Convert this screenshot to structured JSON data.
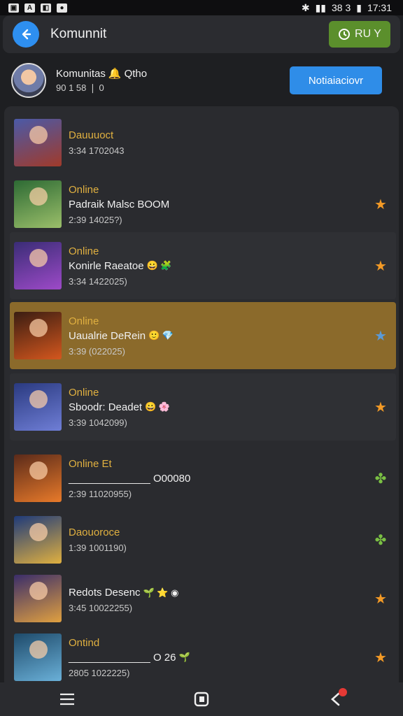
{
  "status_bar": {
    "left_icons": [
      "photo-icon",
      "a-icon",
      "media-icon",
      "chat-icon"
    ],
    "right_text": "38 3",
    "time": "17:31"
  },
  "app_bar": {
    "title": "Komunnit",
    "run_label": "RU Y"
  },
  "profile": {
    "name": "Komunitas",
    "name_suffix": "Qtho",
    "sub": "90 1 58 ❘ 0"
  },
  "notify_button": {
    "label": "Notiaiaciovr"
  },
  "items": [
    {
      "status": "Dauuuoct",
      "title": "",
      "meta": "3:34 1702043",
      "thumb": [
        "#4a5aa8",
        "#a03a2a"
      ],
      "star": "",
      "card": false,
      "hl": false
    },
    {
      "status": "Online",
      "title": "Padraik Malsc BOOM",
      "meta": "2:39 14025?)",
      "thumb": [
        "#2d6a34",
        "#9bbf6a"
      ],
      "star": "★",
      "star_color": "#f39a26",
      "card": false,
      "hl": false
    },
    {
      "status": "Online",
      "title": "Konirle Raeatoe",
      "meta": "3:34 1422025)",
      "thumb": [
        "#3a2d76",
        "#9d4ac8"
      ],
      "star": "★",
      "star_color": "#f39a26",
      "card": true,
      "hl": false,
      "emoji": "😀 🧩"
    },
    {
      "status": "Online",
      "title": "Uaualrie DeRein",
      "meta": "3:39 (022025)",
      "thumb": [
        "#3a1d12",
        "#d4571e"
      ],
      "star": "★",
      "star_color": "#5a9ad8",
      "card": false,
      "hl": true,
      "emoji": "🙂 💎"
    },
    {
      "status": "Online",
      "title": "Sboodr: Deadet",
      "meta": "3:39 1042099)",
      "thumb": [
        "#2a3a80",
        "#6f7ed6"
      ],
      "star": "★",
      "star_color": "#f39a26",
      "card": true,
      "hl": false,
      "emoji": "😀 🌸"
    },
    {
      "status": "Online Et",
      "title": "______________  O00080",
      "meta": "2:39 11020955)",
      "thumb": [
        "#5a2a1a",
        "#e87a2a"
      ],
      "star": "✤",
      "star_color": "#7ac043",
      "card": false,
      "hl": false,
      "emoji": ""
    },
    {
      "status": "Daouoroce",
      "title": "",
      "meta": "1:39 1001190)",
      "thumb": [
        "#1e3a7a",
        "#e0b040"
      ],
      "star": "✤",
      "star_color": "#7ac043",
      "card": false,
      "hl": false
    },
    {
      "status": "",
      "title": "Redots Desenc",
      "meta": "3:45 10022255)",
      "thumb": [
        "#3a2d6a",
        "#e0a040"
      ],
      "star": "★",
      "star_color": "#f39a26",
      "card": false,
      "hl": false,
      "emoji": "🌱 ⭐ ◉"
    },
    {
      "status": "Ontind",
      "title": "______________  O 26",
      "meta": "2805 1022225)",
      "thumb": [
        "#1e4a6a",
        "#6ab0d8"
      ],
      "star": "★",
      "star_color": "#f39a26",
      "card": false,
      "hl": false,
      "emoji": "🌱"
    }
  ],
  "bottom_nav": [
    "menu-icon",
    "home-icon",
    "back-icon"
  ]
}
